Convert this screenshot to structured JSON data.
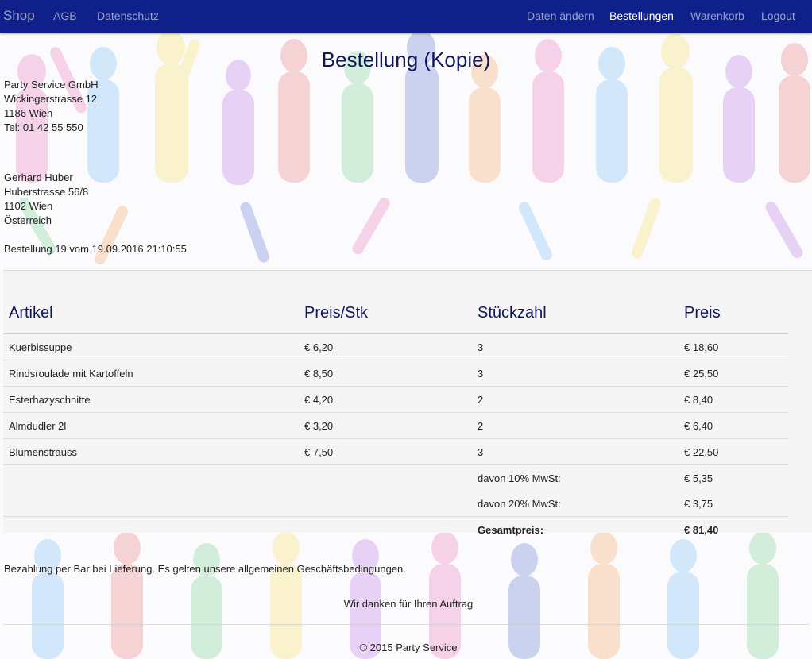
{
  "navbar": {
    "brand": "Shop",
    "left_links": [
      "AGB",
      "Datenschutz"
    ],
    "right_links": [
      "Daten ändern",
      "Bestellungen",
      "Warenkorb",
      "Logout"
    ],
    "active": "Bestellungen",
    "background": "#10208a"
  },
  "page": {
    "title": "Bestellung (Kopie)"
  },
  "seller": {
    "lines": [
      "Party Service GmbH",
      "Wickingerstrasse 12",
      "1186 Wien",
      "Tel: 01 42 55 550"
    ]
  },
  "customer": {
    "lines": [
      "Gerhard Huber",
      "Huberstrasse 56/8",
      "1102 Wien",
      "Österreich"
    ]
  },
  "order": {
    "line": "Bestellung 19 vom 19.09.2016 21:10:55"
  },
  "table": {
    "headers": [
      "Artikel",
      "Preis/Stk",
      "Stückzahl",
      "Preis"
    ],
    "rows": [
      [
        "Kuerbissuppe",
        "€ 6,20",
        "3",
        "€ 18,60"
      ],
      [
        "Rindsroulade mit Kartoffeln",
        "€ 8,50",
        "3",
        "€ 25,50"
      ],
      [
        "Esterhazyschnitte",
        "€ 4,20",
        "2",
        "€ 8,40"
      ],
      [
        "Almdudler 2l",
        "€ 3,20",
        "2",
        "€ 6,40"
      ],
      [
        "Blumenstrauss",
        "€ 7,50",
        "3",
        "€ 22,50"
      ]
    ],
    "vat": [
      {
        "label": "davon 10% MwSt:",
        "value": "€ 5,35"
      },
      {
        "label": "davon 20% MwSt:",
        "value": "€ 3,75"
      }
    ],
    "total": {
      "label": "Gesamtpreis:",
      "value": "€ 81,40"
    }
  },
  "payment_note": "Bezahlung per Bar bei Lieferung. Es gelten unsere allgemeinen Geschäftsbedingungen.",
  "thanks": "Wir danken für Ihren Auftrag",
  "footer": "© 2015 Party Service"
}
